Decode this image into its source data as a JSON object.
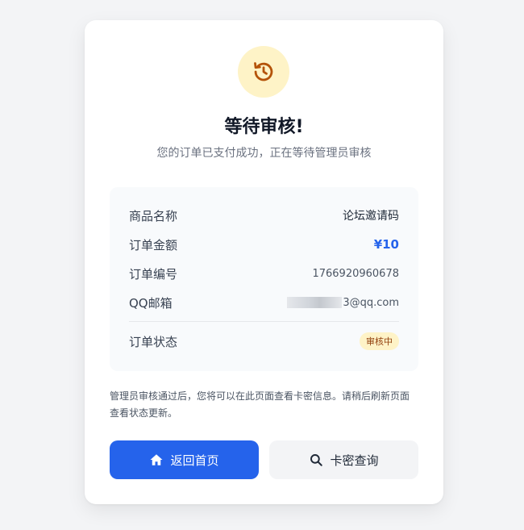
{
  "header": {
    "icon": "history-icon",
    "title": "等待审核!",
    "subtitle": "您的订单已支付成功，正在等待管理员审核"
  },
  "order": {
    "product_label": "商品名称",
    "product_value": "论坛邀请码",
    "amount_label": "订单金额",
    "amount_value": "¥10",
    "number_label": "订单编号",
    "number_value": "1766920960678",
    "qq_label": "QQ邮箱",
    "qq_value": "3@qq.com",
    "status_label": "订单状态",
    "status_value": "审核中"
  },
  "notice": "管理员审核通过后，您将可以在此页面查看卡密信息。请稍后刷新页面查看状态更新。",
  "actions": {
    "home_label": "返回首页",
    "query_label": "卡密查询"
  },
  "colors": {
    "accent": "#2563eb",
    "pending_bg": "#fef3c7",
    "pending_fg": "#b45309"
  }
}
